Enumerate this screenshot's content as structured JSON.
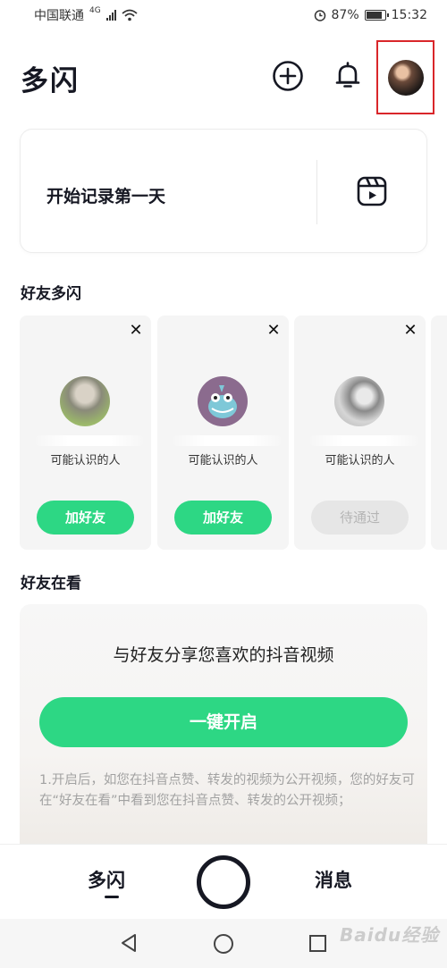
{
  "status_bar": {
    "carrier": "中国联通",
    "network": "4G",
    "battery": "87%",
    "battery_level": 0.87,
    "time": "15:32"
  },
  "header": {
    "title": "多闪"
  },
  "record_card": {
    "text": "开始记录第一天"
  },
  "friends_section": {
    "title": "好友多闪",
    "cards": [
      {
        "subtitle": "可能认识的人",
        "button": "加好友",
        "button_state": "active"
      },
      {
        "subtitle": "可能认识的人",
        "button": "加好友",
        "button_state": "active"
      },
      {
        "subtitle": "可能认识的人",
        "button": "待通过",
        "button_state": "pending"
      }
    ]
  },
  "watching_section": {
    "title": "好友在看",
    "heading": "与好友分享您喜欢的抖音视频",
    "button": "一键开启",
    "description": "1.开启后，如您在抖音点赞、转发的视频为公开视频，您的好友可在“好友在看”中看到您在抖音点赞、转发的公开视频；"
  },
  "tabbar": {
    "feed": "多闪",
    "messages": "消息"
  },
  "watermark": "Baidu经验",
  "colors": {
    "accent": "#2dd784",
    "highlight_box": "#d9262a"
  }
}
